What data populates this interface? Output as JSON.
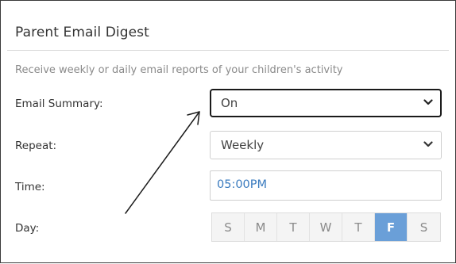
{
  "section": {
    "title": "Parent Email Digest",
    "description": "Receive weekly or daily email reports of your children's activity"
  },
  "fields": {
    "email_summary": {
      "label": "Email Summary:",
      "value": "On"
    },
    "repeat": {
      "label": "Repeat:",
      "value": "Weekly"
    },
    "time": {
      "label": "Time:",
      "value": "05:00PM"
    },
    "day": {
      "label": "Day:",
      "options": [
        "S",
        "M",
        "T",
        "W",
        "T",
        "F",
        "S"
      ],
      "selected_index": 5
    }
  },
  "icons": {
    "dropdown": "chevron-down-icon",
    "annotation": "arrow-annotation"
  },
  "colors": {
    "selected_day": "#6a9fd8",
    "time_text": "#3a7bbf",
    "focus_border": "#1a1a1a"
  }
}
